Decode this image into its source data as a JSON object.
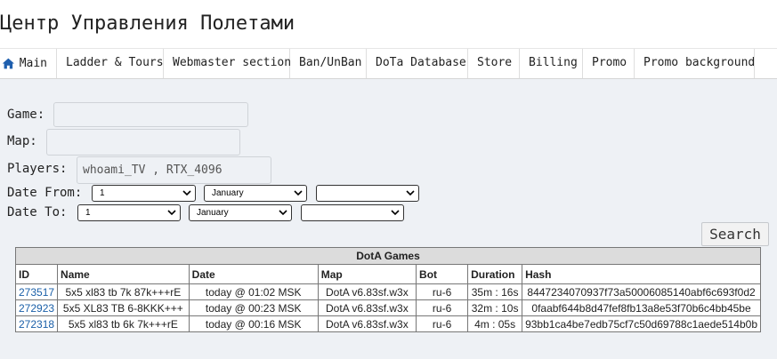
{
  "site": {
    "title": "Центр Управления Полетами"
  },
  "nav": [
    {
      "label": "Main",
      "icon": "home-icon"
    },
    {
      "label": "Ladder & Tours"
    },
    {
      "label": "Webmaster section"
    },
    {
      "label": "Ban/UnBan"
    },
    {
      "label": "DoTa Database"
    },
    {
      "label": "Store"
    },
    {
      "label": "Billing"
    },
    {
      "label": "Promo"
    },
    {
      "label": "Promo background"
    }
  ],
  "form": {
    "game_label": "Game:",
    "game_value": "",
    "map_label": "Map:",
    "map_value": "",
    "players_label": "Players:",
    "players_value": "whoami_TV , RTX_4096",
    "date_from_label": "Date From:",
    "date_from": {
      "day": "1",
      "month": "January",
      "year": ""
    },
    "date_to_label": "Date To:",
    "date_to": {
      "day": "1",
      "month": "January",
      "year": ""
    },
    "search_label": "Search"
  },
  "table": {
    "caption": "DotA Games",
    "columns": [
      "ID",
      "Name",
      "Date",
      "Map",
      "Bot",
      "Duration",
      "Hash"
    ],
    "rows": [
      {
        "id": "273517",
        "name": "5x5 xl83 tb 7k 87k+++rE",
        "date": "today @ 01:02 MSK",
        "map": "DotA v6.83sf.w3x",
        "bot": "ru-6",
        "duration": "35m : 16s",
        "hash": "8447234070937f73a50006085140abf6c693f0d2"
      },
      {
        "id": "272923",
        "name": "5x5 XL83 TB 6-8KKK+++",
        "date": "today @ 00:23 MSK",
        "map": "DotA v6.83sf.w3x",
        "bot": "ru-6",
        "duration": "32m : 10s",
        "hash": "0faabf644b8d47fef8fb13a8e53f70b6c4bb45be"
      },
      {
        "id": "272318",
        "name": "5x5 xl83 tb 6k 7k+++rE",
        "date": "today @ 00:16 MSK",
        "map": "DotA v6.83sf.w3x",
        "bot": "ru-6",
        "duration": "4m : 05s",
        "hash": "93bb1ca4be7edb75cf7c50d69788c1aede514b0b"
      }
    ]
  },
  "colors": {
    "link": "#1a5fa8",
    "home_icon": "#1f5fae",
    "header_bg": "#ffffff",
    "page_bg": "#eef1f5"
  }
}
